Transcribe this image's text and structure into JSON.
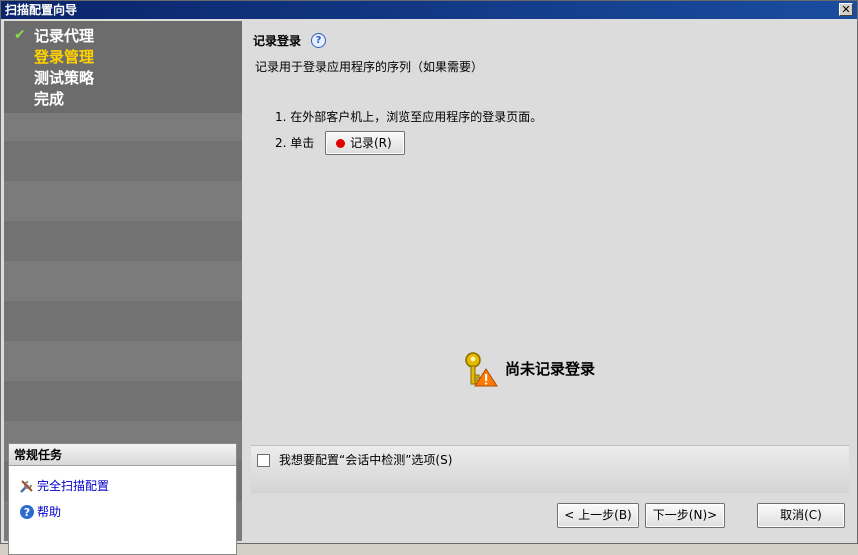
{
  "window": {
    "title": "扫描配置向导",
    "close_label": "✕"
  },
  "steps": [
    {
      "label": "记录代理",
      "done": true
    },
    {
      "label": "登录管理",
      "active": true
    },
    {
      "label": "测试策略"
    },
    {
      "label": "完成"
    }
  ],
  "tasks": {
    "header": "常规任务",
    "items": [
      {
        "label": "完全扫描配置",
        "icon": "tools-icon"
      },
      {
        "label": "帮助",
        "icon": "help-icon"
      }
    ]
  },
  "main": {
    "title": "记录登录",
    "description": "记录用于登录应用程序的序列（如果需要）",
    "step1": "1.  在外部客户机上，浏览至应用程序的登录页面。",
    "step2_prefix": "2.  单击",
    "record_button": "记录(R)",
    "status_text": "尚未记录登录",
    "option_label": "我想要配置“会话中检测”选项(S)",
    "option_checked": false
  },
  "buttons": {
    "back": "< 上一步(B)",
    "next": "下一步(N)>",
    "cancel": "取消(C)"
  },
  "colors": {
    "active_step": "#ffd200",
    "titlebar": "#0a246a",
    "record_dot": "#e00000"
  }
}
